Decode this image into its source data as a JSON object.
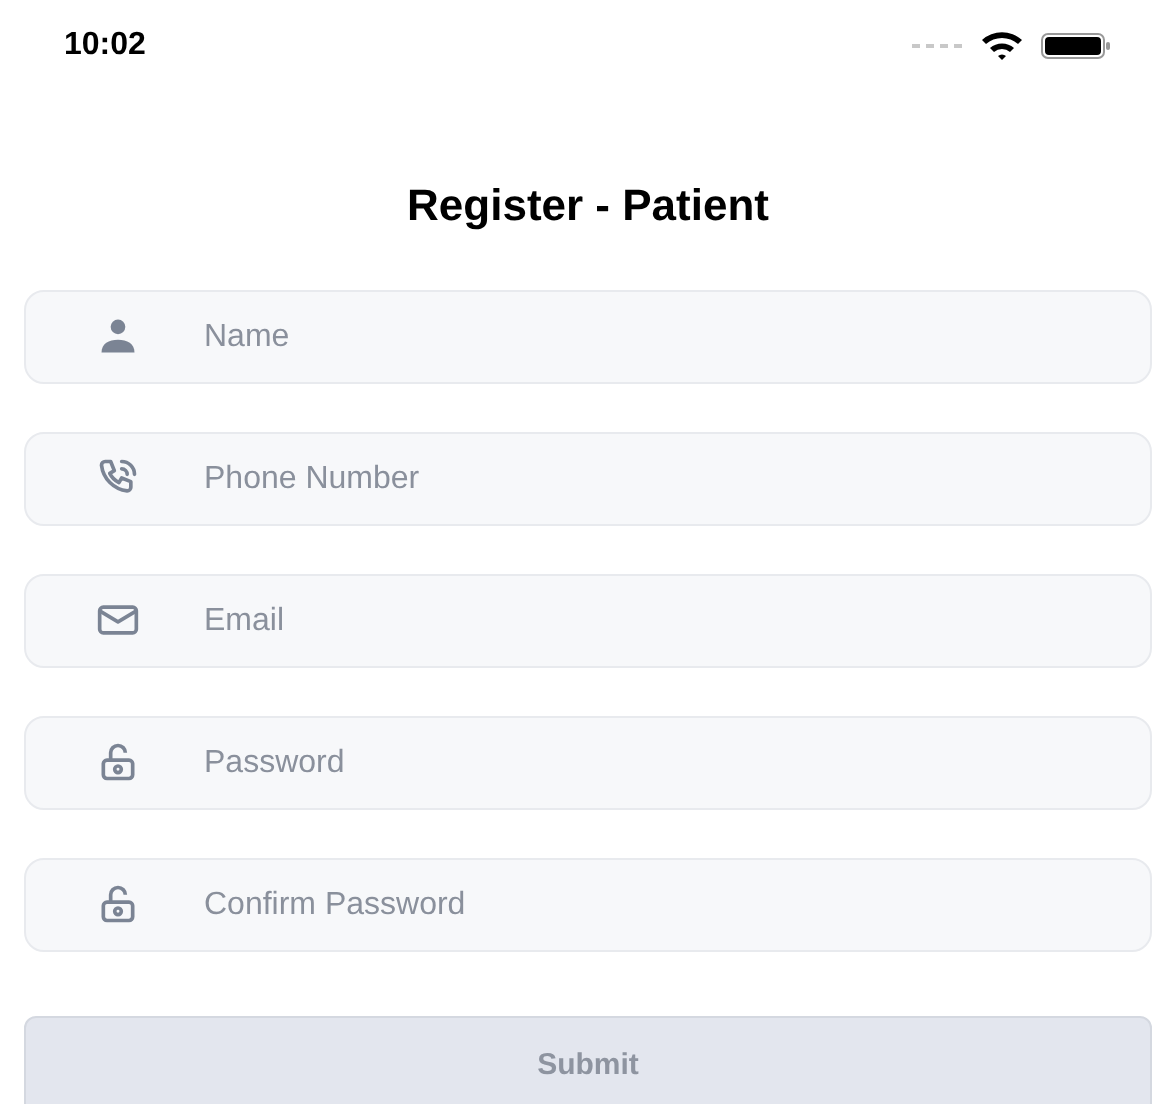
{
  "status_bar": {
    "time": "10:02"
  },
  "title": "Register - Patient",
  "fields": [
    {
      "kind": "name",
      "placeholder": "Name"
    },
    {
      "kind": "phone",
      "placeholder": "Phone Number"
    },
    {
      "kind": "email",
      "placeholder": "Email"
    },
    {
      "kind": "password",
      "placeholder": "Password"
    },
    {
      "kind": "password",
      "placeholder": "Confirm Password"
    }
  ],
  "submit": {
    "label": "Submit",
    "disabled": true
  }
}
